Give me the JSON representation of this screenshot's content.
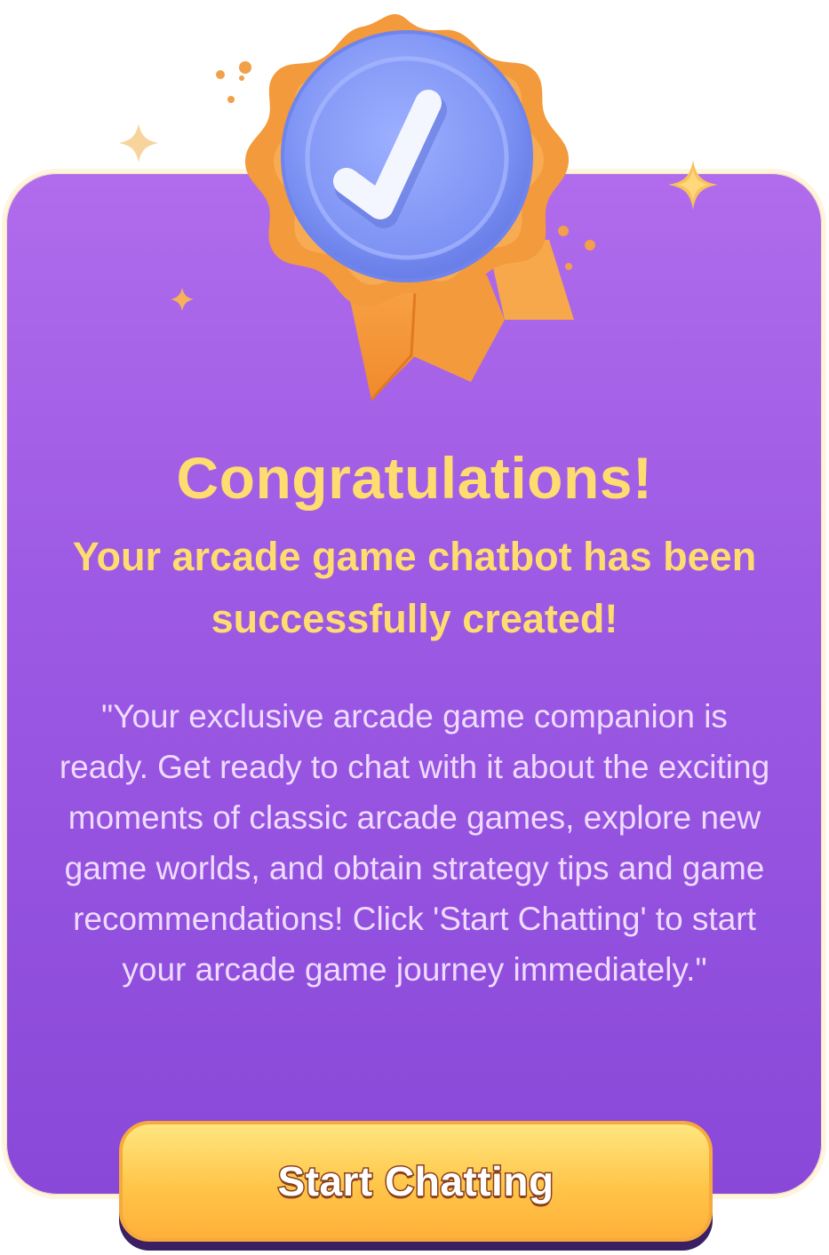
{
  "dialog": {
    "title": "Congratulations!",
    "subtitle": "Your arcade game chatbot has been successfully created!",
    "description": "\"Your exclusive arcade game companion is ready. Get ready to chat with it about the exciting moments of classic arcade games, explore new game worlds, and obtain strategy tips and game recommendations! Click 'Start Chatting' to start your arcade game journey immediately.\"",
    "button_label": "Start Chatting",
    "medal_icon": "check-badge-icon",
    "decorations": [
      "sparkle-icon",
      "sparkle-icon",
      "sparkle-icon",
      "confetti-dots"
    ]
  },
  "colors": {
    "card_top": "#b06cec",
    "card_bottom": "#8a48d9",
    "title_yellow": "#fedc6f",
    "body_text": "#eedbff",
    "button_yellow": "#ffc548",
    "medal_orange": "#f39a3c",
    "medal_blue": "#8ea3fb"
  }
}
